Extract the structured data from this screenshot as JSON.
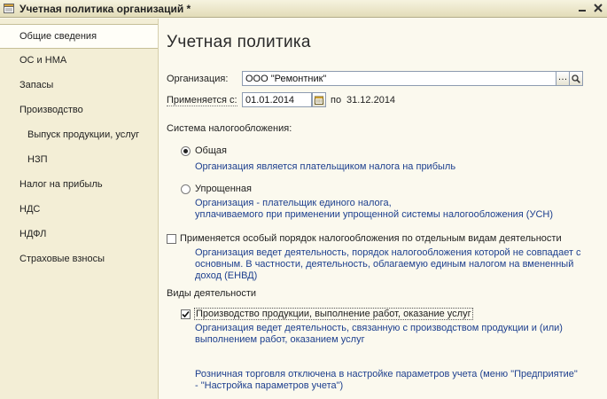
{
  "window": {
    "title": "Учетная политика организаций *",
    "icon": "document-icon",
    "buttons": [
      "minimize-icon",
      "close-icon"
    ]
  },
  "sidebar": {
    "items": [
      {
        "label": "Общие сведения",
        "active": true
      },
      {
        "label": "ОС и НМА",
        "active": false
      },
      {
        "label": "Запасы",
        "active": false
      },
      {
        "label": "Производство",
        "active": false
      },
      {
        "label": "Выпуск продукции, услуг",
        "active": false,
        "sub": true
      },
      {
        "label": "НЗП",
        "active": false,
        "sub": true
      },
      {
        "label": "Налог на прибыль",
        "active": false
      },
      {
        "label": "НДС",
        "active": false
      },
      {
        "label": "НДФЛ",
        "active": false
      },
      {
        "label": "Страховые взносы",
        "active": false
      }
    ]
  },
  "main": {
    "title": "Учетная политика",
    "organization_label": "Организация:",
    "organization_value": "ООО \"Ремонтник\"",
    "applies_label": "Применяется с:",
    "applies_from": "01.01.2014",
    "applies_to_label": "по",
    "applies_to": "31.12.2014",
    "tax_system_label": "Система налогообложения:",
    "tax_options": [
      {
        "label": "Общая",
        "selected": true,
        "description": "Организация является плательщиком налога на прибыль"
      },
      {
        "label": "Упрощенная",
        "selected": false,
        "description_lines": [
          "Организация - плательщик единого налога,",
          "уплачиваемого при применении упрощенной системы налогообложения (УСН)"
        ]
      }
    ],
    "special_order": {
      "label": "Применяется особый порядок налогообложения по отдельным видам деятельности",
      "checked": false,
      "description_lines": [
        "Организация ведет деятельность, порядок налогообложения которой не совпадает с",
        "основным. В частности, деятельность, облагаемую единым налогом на вмененный",
        "доход (ЕНВД)"
      ]
    },
    "activities_label": "Виды деятельности",
    "production": {
      "label": "Производство  продукции, выполнение работ, оказание услуг",
      "checked": true,
      "description_lines": [
        "Организация ведет деятельность, связанную с производством продукции и (или)",
        "выполнением работ, оказанием услуг"
      ]
    },
    "retail_note_lines": [
      "Розничная торговля отключена в настройке параметров учета (меню \"Предприятие\"",
      "- \"Настройка параметров учета\")"
    ]
  },
  "colors": {
    "background": "#fbf9ee",
    "sidebar": "#f3eed6",
    "link_blue": "#1d3f8e"
  }
}
